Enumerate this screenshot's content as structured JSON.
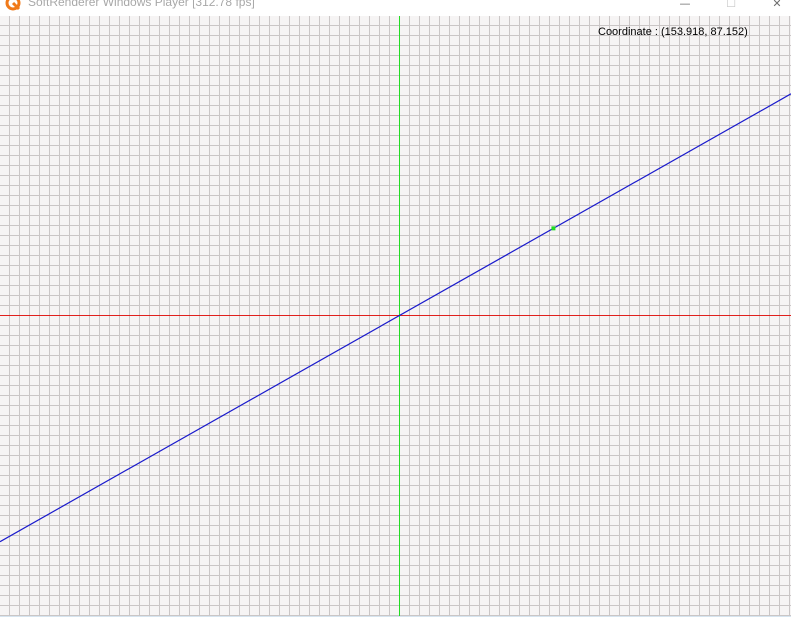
{
  "window": {
    "title": "SoftRenderer Windows Player [312.78 fps]",
    "minimize_glyph": "—",
    "maximize_glyph": "☐",
    "close_glyph": "✕",
    "icon": "softrenderer-app-icon"
  },
  "viewport": {
    "coordinate_readout": "Coordinate : (153.918, 87.152)",
    "x_axis_color": "#e0201c",
    "y_axis_color": "#22dd22",
    "line_color": "#1a1acc",
    "cursor_marker_color": "#22dd22",
    "grid_color": "#cac6c6",
    "background_color": "#f6f4f4",
    "cursor_point": {
      "x": 153.918,
      "y": 87.152
    },
    "line_slope": 0.5662
  }
}
